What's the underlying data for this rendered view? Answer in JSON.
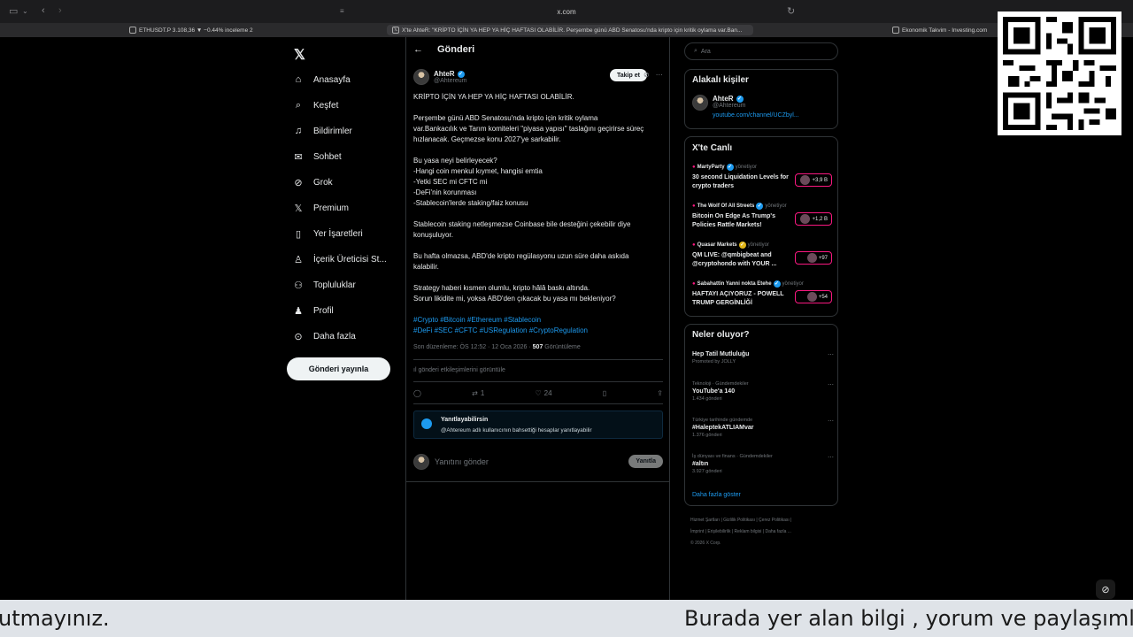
{
  "browser": {
    "url": "x.com",
    "tabs": [
      {
        "label": "ETHUSDT.P 3.108,36 ▼ −0.44% inceleme 2",
        "active": false
      },
      {
        "label": "X'te AhteR: \"KRİPTO İÇİN YA HEP YA HİÇ HAFTASI OLABİLİR. Perşembe günü ABD Senatosu'nda kripto için kritik oylama var.Ban...",
        "active": true
      },
      {
        "label": "Ekonomik Takvim - Investing.com",
        "active": false
      }
    ]
  },
  "nav": {
    "items": [
      {
        "label": "Anasayfa",
        "icon": "home-icon"
      },
      {
        "label": "Keşfet",
        "icon": "search-icon"
      },
      {
        "label": "Bildirimler",
        "icon": "bell-icon"
      },
      {
        "label": "Sohbet",
        "icon": "mail-icon"
      },
      {
        "label": "Grok",
        "icon": "grok-icon"
      },
      {
        "label": "Premium",
        "icon": "x-icon"
      },
      {
        "label": "Yer İşaretleri",
        "icon": "bookmark-icon"
      },
      {
        "label": "İçerik Üreticisi St...",
        "icon": "creator-icon"
      },
      {
        "label": "Topluluklar",
        "icon": "people-icon"
      },
      {
        "label": "Profil",
        "icon": "person-icon"
      },
      {
        "label": "Daha fazla",
        "icon": "more-icon"
      }
    ],
    "post_button": "Gönderi yayınla"
  },
  "post": {
    "header_title": "Gönderi",
    "author_name": "AhteR",
    "author_handle": "@Ahtereum",
    "follow_label": "Takip et",
    "p1": "KRİPTO İÇİN YA HEP YA HİÇ HAFTASI OLABİLİR.",
    "p2": "Perşembe günü ABD Senatosu'nda kripto için kritik oylama\nvar.Bankacılık ve Tarım komiteleri \"piyasa yapısı\" taslağını geçirirse süreç\nhızlanacak. Geçmezse konu 2027'ye sarkabilir.",
    "p3": "Bu yasa neyi belirleyecek?\n-Hangi coin menkul kıymet, hangisi emtia\n-Yetki SEC mi CFTC mi\n-DeFi'nin korunması\n-Stablecoin'lerde staking/faiz konusu",
    "p4": "Stablecoin staking netleşmezse Coinbase bile desteğini çekebilir diye\nkonuşuluyor.",
    "p5": "Bu hafta olmazsa, ABD'de kripto regülasyonu uzun süre daha askıda\nkalabilir.",
    "p6": "Strategy haberi kısmen olumlu, kripto hâlâ baskı altında.\nSorun likidite mi, yoksa ABD'den çıkacak bu yasa mı bekleniyor?",
    "hashtags": "#Crypto #Bitcoin #Ethereum #Stablecoin\n#DeFi #SEC #CFTC #USRegulation #CryptoRegulation",
    "edited": "Son düzenleme: ÖS 12:52 · 12 Oca 2026 ·",
    "views": "507",
    "views_label": "Görüntüleme",
    "engagement_link": "gönderi etkileşimlerini görüntüle",
    "reposts": "1",
    "likes": "24",
    "reply_notice_title": "Yanıtlayabilirsin",
    "reply_notice_sub": "@Ahtereum adlı kullanıcının bahsettiği hesaplar yanıtlayabilir",
    "reply_placeholder": "Yanıtını gönder",
    "reply_button": "Yanıtla"
  },
  "sidebar": {
    "search_placeholder": "Ara",
    "related_title": "Alakalı kişiler",
    "related_name": "AhteR",
    "related_handle": "@Ahtereum",
    "related_link": "youtube.com/channel/UCZbyl...",
    "live_title": "X'te Canlı",
    "live_items": [
      {
        "host": "MartyParty",
        "meta": "yönetiyor",
        "title": "30 second Liquidation Levels for crypto traders",
        "badge": "+3,9 B"
      },
      {
        "host": "The Wolf Of All Streets",
        "meta": "yönetiyor",
        "title": "Bitcoin On Edge As Trump's Policies Rattle Markets!",
        "badge": "+1,2 B"
      },
      {
        "host": "Quasar Markets",
        "meta": "yönetiyor",
        "title": "QM LIVE: @qmbigbeat and @cryptohondo with YOUR ...",
        "badge": "+97"
      },
      {
        "host": "Sabahattin Yanni nokta Etehe",
        "meta": "yönetiyor",
        "title": "HAFTAYI AÇIYORUZ - POWELL TRUMP GERGİNLİĞİ",
        "badge": "+54"
      }
    ],
    "trends_title": "Neler oluyor?",
    "trends": [
      {
        "category": "Promoted by JOLLY",
        "name": "Hep Tatil Mutluluğu",
        "count": ""
      },
      {
        "category": "Teknoloji · Gündemdekiler",
        "name": "YouTube'a 140",
        "count": "1.434 gönderi"
      },
      {
        "category": "Türkiye tarihinde gündemde",
        "name": "#HaleptekATLIAMvar",
        "count": "1.376 gönderi"
      },
      {
        "category": "İş dünyası ve finans · Gündemdekiler",
        "name": "#altın",
        "count": "3.927 gönderi"
      }
    ],
    "show_more": "Daha fazla göster",
    "footer_line1": "Hizmet Şartları  |  Gizlilik Politikası  |  Çerez Politikası  |",
    "footer_line2": "İmprint  |  Erişilebilirlik  |  Reklam bilgisi  |  Daha fazla ...",
    "footer_line3": "© 2026 X Corp."
  },
  "ticker": {
    "left": "utmayınız.",
    "right": "Burada yer alan bilgi , yorum ve paylaşımla"
  },
  "colors": {
    "accent": "#1d9bf0",
    "live": "#f91880",
    "bg": "#000000"
  }
}
